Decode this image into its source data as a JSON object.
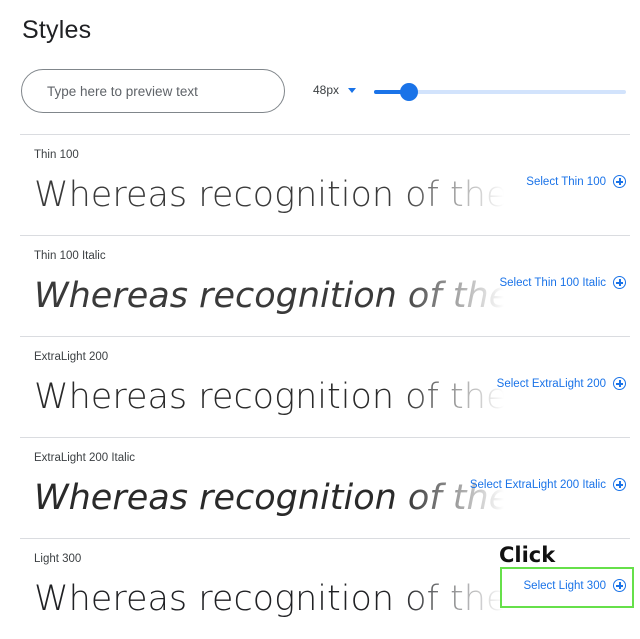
{
  "page": {
    "title": "Styles"
  },
  "controls": {
    "search_placeholder": "Type here to preview text",
    "size_value": "48px",
    "slider_level": 0.14
  },
  "styles": [
    {
      "label": "Thin 100",
      "preview": "Whereas recognition of the inherent dignity",
      "select_label": "Select Thin 100"
    },
    {
      "label": "Thin 100 Italic",
      "preview": "Whereas recognition of the inherent dignity",
      "select_label": "Select Thin 100 Italic"
    },
    {
      "label": "ExtraLight 200",
      "preview": "Whereas recognition of the inherent dignity",
      "select_label": "Select ExtraLight 200"
    },
    {
      "label": "ExtraLight 200 Italic",
      "preview": "Whereas recognition of the inherent dignity",
      "select_label": "Select ExtraLight 200 Italic"
    },
    {
      "label": "Light 300",
      "preview": "Whereas recognition of the inherent dignity",
      "select_label": "Select Light 300"
    }
  ],
  "annotation": {
    "text": "Click",
    "highlight_color": "#66e04a"
  },
  "colors": {
    "accent": "#1a73e8",
    "track": "#d2e3fc",
    "divider": "#dadce0"
  }
}
